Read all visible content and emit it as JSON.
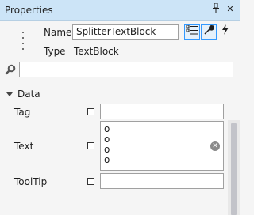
{
  "titlebar": {
    "title": "Properties",
    "pin_glyph": "⊥",
    "close_glyph": "✕"
  },
  "header": {
    "name_label": "Name",
    "name_value": "SplitterTextBlock",
    "type_label": "Type",
    "type_value": "TextBlock",
    "buttons": [
      {
        "name": "categorized-view-icon",
        "glyph": "☰",
        "active": true
      },
      {
        "name": "wrench-icon",
        "glyph": "🔧",
        "active": true
      },
      {
        "name": "lightning-icon",
        "glyph": "ϟ",
        "active": false
      }
    ]
  },
  "search": {
    "placeholder": ""
  },
  "category": {
    "label": "Data"
  },
  "properties": [
    {
      "label": "Tag",
      "value": ""
    },
    {
      "label": "Text",
      "lines": [
        "o",
        "o",
        "o",
        "o"
      ]
    },
    {
      "label": "ToolTip",
      "value": ""
    }
  ],
  "colors": {
    "titlebar": "#cce4f7",
    "accent": "#3399ff",
    "panel": "#f5f5f5"
  },
  "icons": [
    "pin-icon",
    "close-icon",
    "drag-grip-icon",
    "search-icon",
    "clear-icon"
  ]
}
